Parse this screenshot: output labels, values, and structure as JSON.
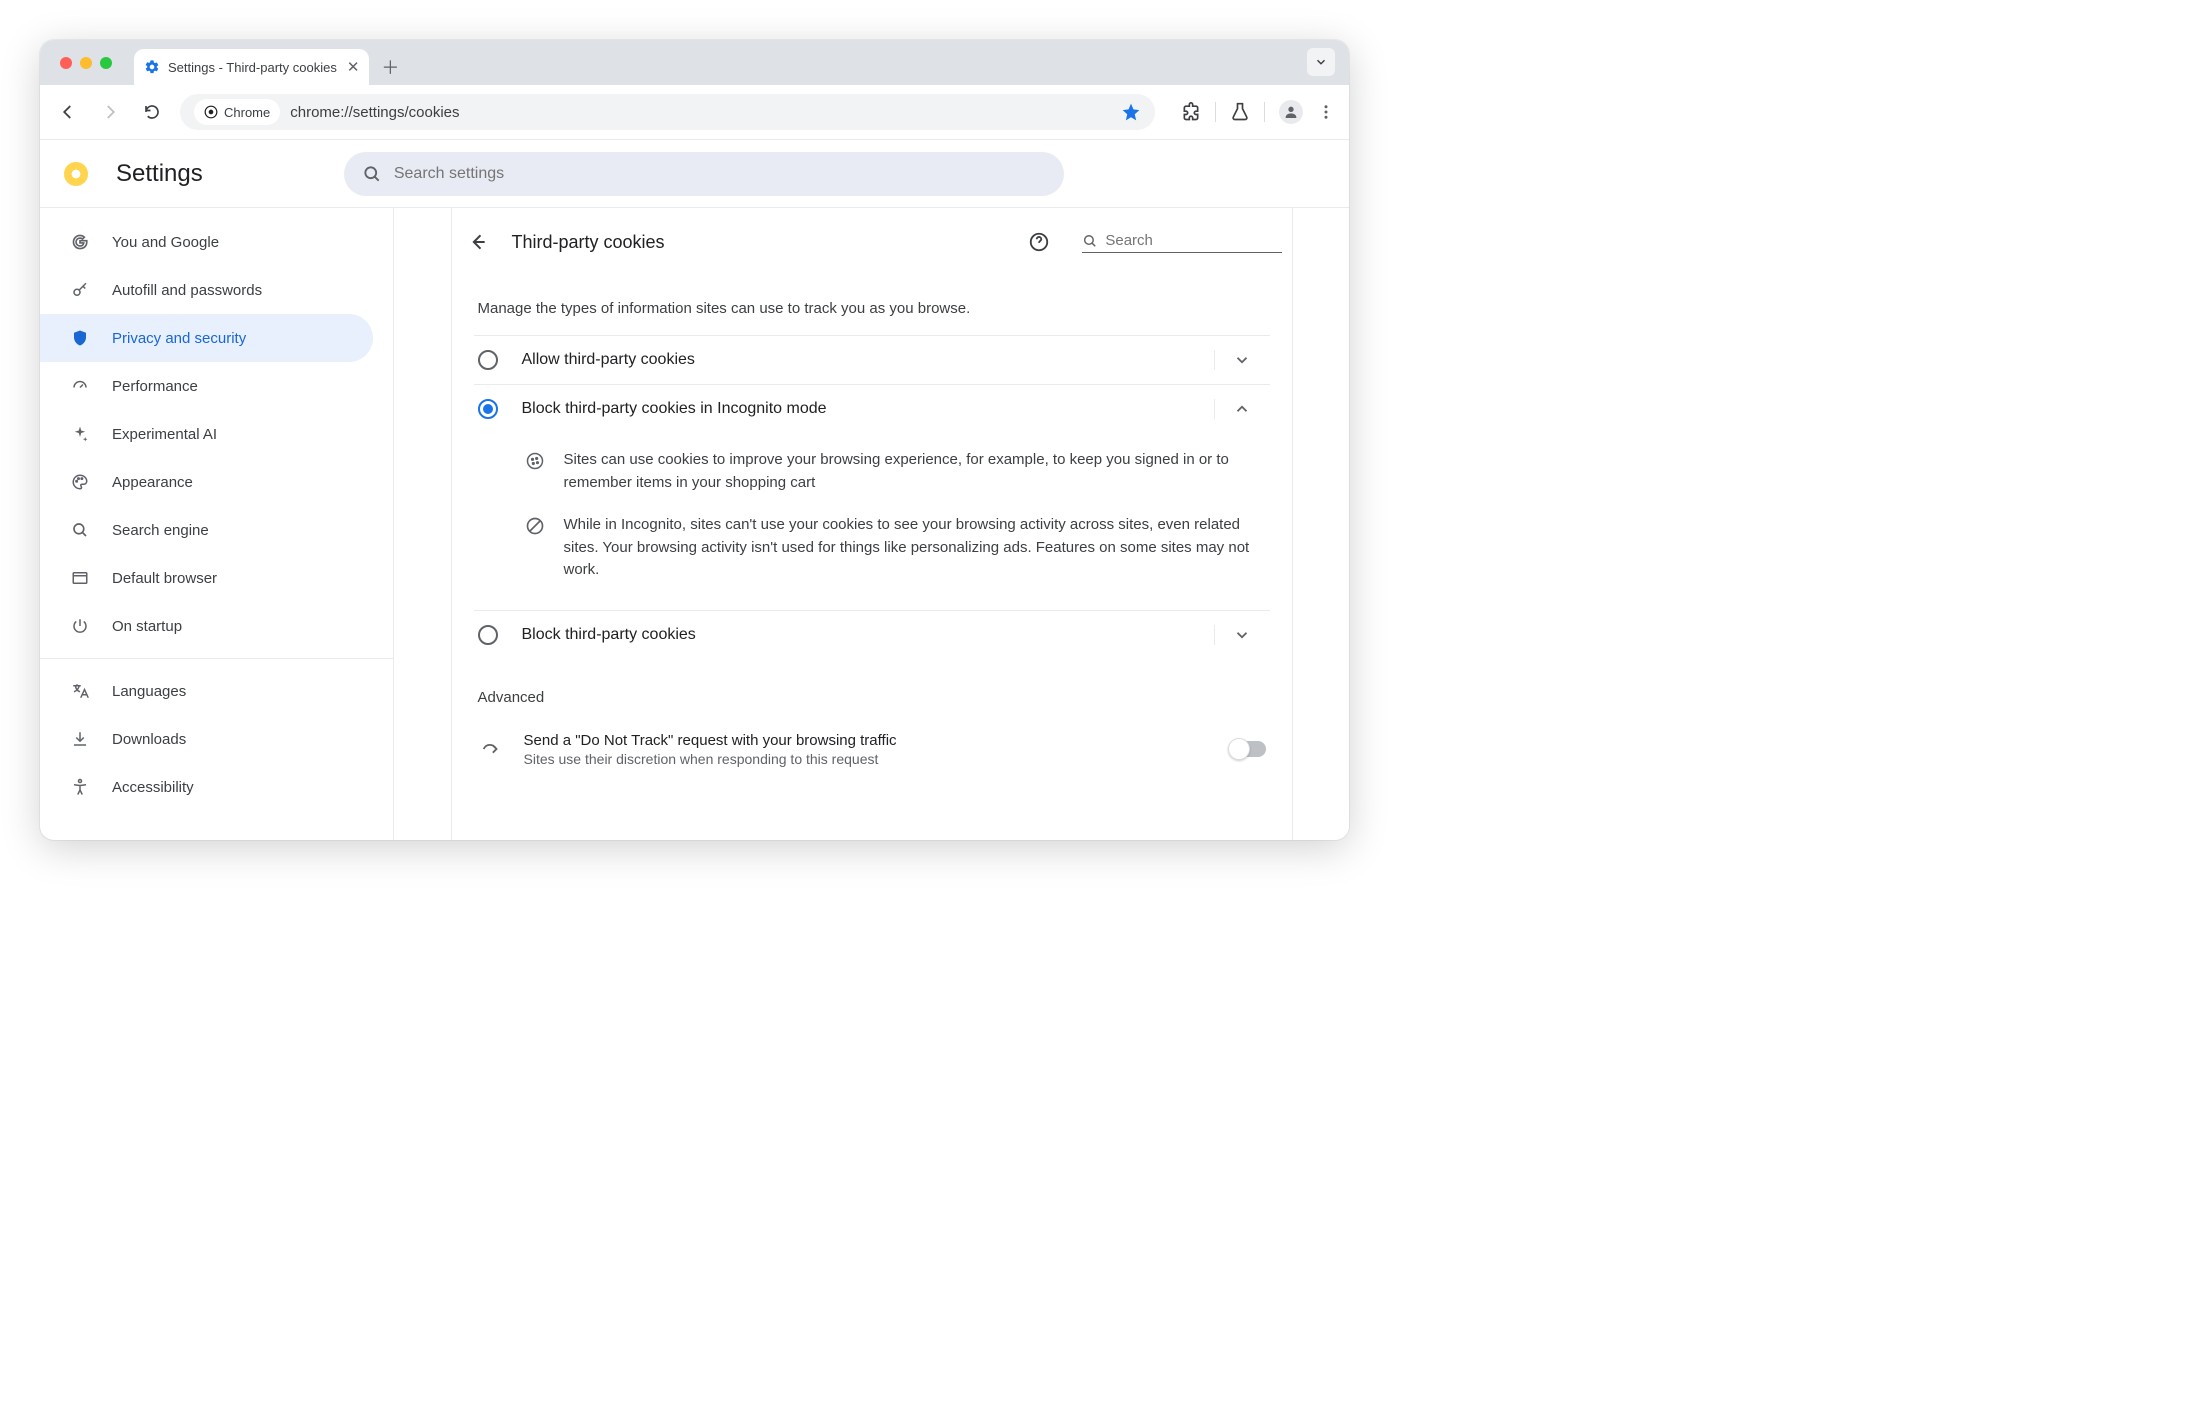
{
  "window": {
    "tab_title": "Settings - Third-party cookies",
    "omnibox_chip": "Chrome",
    "omnibox_url": "chrome://settings/cookies"
  },
  "header": {
    "app_title": "Settings",
    "search_placeholder": "Search settings"
  },
  "sidebar": {
    "primary": [
      {
        "label": "You and Google",
        "icon": "google-g-icon"
      },
      {
        "label": "Autofill and passwords",
        "icon": "key-icon"
      },
      {
        "label": "Privacy and security",
        "icon": "shield-icon",
        "active": true
      },
      {
        "label": "Performance",
        "icon": "speedometer-icon"
      },
      {
        "label": "Experimental AI",
        "icon": "sparkle-icon"
      },
      {
        "label": "Appearance",
        "icon": "palette-icon"
      },
      {
        "label": "Search engine",
        "icon": "search-icon"
      },
      {
        "label": "Default browser",
        "icon": "browser-icon"
      },
      {
        "label": "On startup",
        "icon": "power-icon"
      }
    ],
    "secondary": [
      {
        "label": "Languages",
        "icon": "translate-icon"
      },
      {
        "label": "Downloads",
        "icon": "download-icon"
      },
      {
        "label": "Accessibility",
        "icon": "accessibility-icon"
      }
    ]
  },
  "panel": {
    "title": "Third-party cookies",
    "search_placeholder": "Search",
    "intro": "Manage the types of information sites can use to track you as you browse.",
    "options": {
      "allow": "Allow third-party cookies",
      "block_incognito": "Block third-party cookies in Incognito mode",
      "block_all": "Block third-party cookies"
    },
    "details": {
      "line1": "Sites can use cookies to improve your browsing experience, for example, to keep you signed in or to remember items in your shopping cart",
      "line2": "While in Incognito, sites can't use your cookies to see your browsing activity across sites, even related sites. Your browsing activity isn't used for things like personalizing ads. Features on some sites may not work."
    },
    "advanced_label": "Advanced",
    "dnt": {
      "title": "Send a \"Do Not Track\" request with your browsing traffic",
      "subtitle": "Sites use their discretion when responding to this request"
    }
  }
}
